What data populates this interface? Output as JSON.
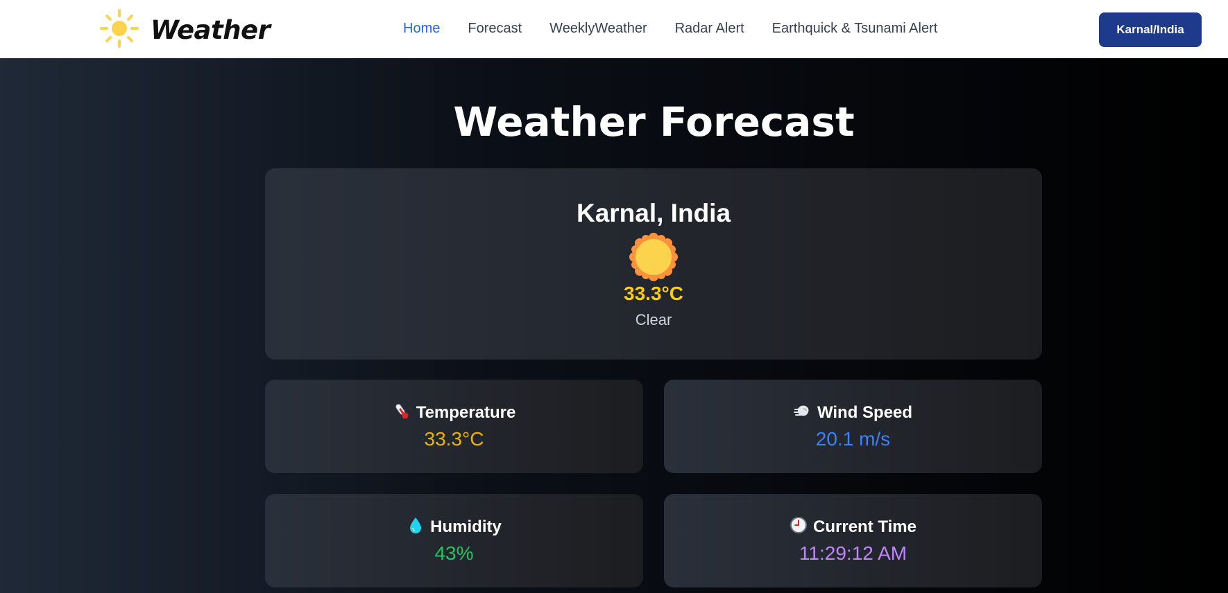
{
  "brand": {
    "name": "Weather",
    "icon": "sun-icon"
  },
  "nav": {
    "items": [
      {
        "label": "Home",
        "active": true
      },
      {
        "label": "Forecast",
        "active": false
      },
      {
        "label": "WeeklyWeather",
        "active": false
      },
      {
        "label": "Radar Alert",
        "active": false
      },
      {
        "label": "Earthquick & Tsunami Alert",
        "active": false
      }
    ],
    "location_button": "Karnal/India"
  },
  "page": {
    "title": "Weather Forecast"
  },
  "current": {
    "city": "Karnal, India",
    "icon": "sun-icon",
    "temperature": "33.3°C",
    "condition": "Clear"
  },
  "stats": [
    {
      "label": "Temperature",
      "value": "33.3°C",
      "icon": "thermometer-icon",
      "color": "#eab308"
    },
    {
      "label": "Wind Speed",
      "value": "20.1 m/s",
      "icon": "wind-icon",
      "color": "#3b82f6"
    },
    {
      "label": "Humidity",
      "value": "43%",
      "icon": "droplet-icon",
      "color": "#22c55e"
    },
    {
      "label": "Current Time",
      "value": "11:29:12 AM",
      "icon": "clock-icon",
      "color": "#c084fc"
    }
  ],
  "colors": {
    "nav_active": "#2563eb",
    "button_bg": "#1e3a8a",
    "temp_yellow": "#facc15"
  }
}
